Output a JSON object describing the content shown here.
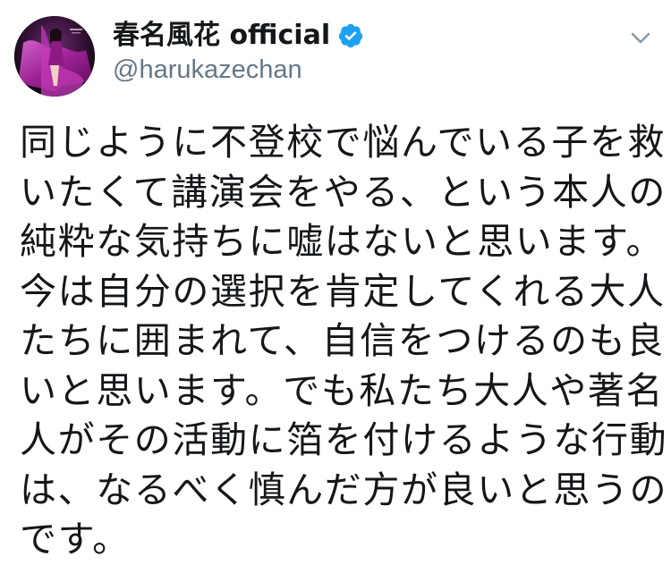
{
  "tweet": {
    "display_name": "春名風花 official",
    "handle": "@harukazechan",
    "verified": true,
    "avatar_icon": "profile-photo",
    "verified_icon": "verified-checkmark-icon",
    "menu_icon": "chevron-down-icon",
    "accent_color": "#1da1f2",
    "text_lines": [
      "同じように不登校で悩んでいる子を救",
      "いたくて講演会をやる、という本人の",
      "純粋な気持ちに嘘はないと思います。",
      "今は自分の選択を肯定してくれる大人",
      "たちに囲まれて、自信をつけるのも良",
      "いと思います。でも私たち大人や著名",
      "人がその活動に箔を付けるような行動",
      "は、なるべく慎んだ方が良いと思うの",
      "です。"
    ]
  }
}
